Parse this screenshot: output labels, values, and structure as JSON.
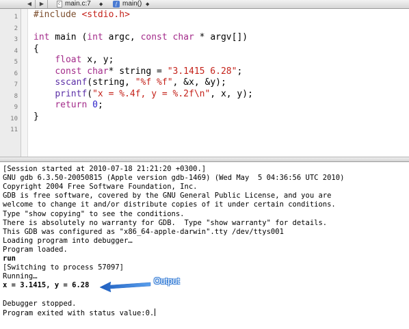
{
  "navbar": {
    "back_icon": "back-arrow-icon",
    "forward_icon": "forward-arrow-icon",
    "file_label": "main.c:7",
    "function_label": "main()",
    "stepper_glyph": "◆"
  },
  "editor": {
    "line_numbers": [
      "1",
      "2",
      "3",
      "4",
      "5",
      "6",
      "7",
      "8",
      "9",
      "10",
      "11"
    ],
    "lines": [
      [
        {
          "t": "#include ",
          "c": "pp"
        },
        {
          "t": "<stdio.h>",
          "c": "str"
        }
      ],
      [],
      [
        {
          "t": "int",
          "c": "kw"
        },
        {
          "t": " main (",
          "c": "plain"
        },
        {
          "t": "int",
          "c": "kw"
        },
        {
          "t": " argc, ",
          "c": "plain"
        },
        {
          "t": "const",
          "c": "kw"
        },
        {
          "t": " ",
          "c": "plain"
        },
        {
          "t": "char",
          "c": "kw"
        },
        {
          "t": " * argv[])",
          "c": "plain"
        }
      ],
      [
        {
          "t": "{",
          "c": "plain"
        }
      ],
      [
        {
          "t": "    ",
          "c": "plain"
        },
        {
          "t": "float",
          "c": "kw"
        },
        {
          "t": " x, y;",
          "c": "plain"
        }
      ],
      [
        {
          "t": "    ",
          "c": "plain"
        },
        {
          "t": "const",
          "c": "kw"
        },
        {
          "t": " ",
          "c": "plain"
        },
        {
          "t": "char",
          "c": "kw"
        },
        {
          "t": "* string = ",
          "c": "plain"
        },
        {
          "t": "\"3.1415 6.28\"",
          "c": "str"
        },
        {
          "t": ";",
          "c": "plain"
        }
      ],
      [
        {
          "t": "    ",
          "c": "plain"
        },
        {
          "t": "sscanf",
          "c": "fn"
        },
        {
          "t": "(string, ",
          "c": "plain"
        },
        {
          "t": "\"%f %f\"",
          "c": "str"
        },
        {
          "t": ", &x, &y);",
          "c": "plain"
        }
      ],
      [
        {
          "t": "    ",
          "c": "plain"
        },
        {
          "t": "printf",
          "c": "fn"
        },
        {
          "t": "(",
          "c": "plain"
        },
        {
          "t": "\"x = %.4f, y = %.2f\\n\"",
          "c": "str"
        },
        {
          "t": ", x, y);",
          "c": "plain"
        }
      ],
      [
        {
          "t": "    ",
          "c": "plain"
        },
        {
          "t": "return",
          "c": "kw"
        },
        {
          "t": " ",
          "c": "plain"
        },
        {
          "t": "0",
          "c": "num"
        },
        {
          "t": ";",
          "c": "plain"
        }
      ],
      [
        {
          "t": "}",
          "c": "plain"
        }
      ],
      []
    ]
  },
  "console": {
    "lines": [
      {
        "text": "[Session started at 2010-07-18 21:21:20 +0300.]",
        "bold": false
      },
      {
        "text": "GNU gdb 6.3.50-20050815 (Apple version gdb-1469) (Wed May  5 04:36:56 UTC 2010)",
        "bold": false
      },
      {
        "text": "Copyright 2004 Free Software Foundation, Inc.",
        "bold": false
      },
      {
        "text": "GDB is free software, covered by the GNU General Public License, and you are",
        "bold": false
      },
      {
        "text": "welcome to change it and/or distribute copies of it under certain conditions.",
        "bold": false
      },
      {
        "text": "Type \"show copying\" to see the conditions.",
        "bold": false
      },
      {
        "text": "There is absolutely no warranty for GDB.  Type \"show warranty\" for details.",
        "bold": false
      },
      {
        "text": "This GDB was configured as \"x86_64-apple-darwin\".tty /dev/ttys001",
        "bold": false
      },
      {
        "text": "Loading program into debugger…",
        "bold": false
      },
      {
        "text": "Program loaded.",
        "bold": false
      },
      {
        "text": "run",
        "bold": true
      },
      {
        "text": "[Switching to process 57097]",
        "bold": false
      },
      {
        "text": "Running…",
        "bold": false
      },
      {
        "text": "x = 3.1415, y = 6.28",
        "bold": true
      },
      {
        "text": "",
        "bold": false
      },
      {
        "text": "Debugger stopped.",
        "bold": false
      },
      {
        "text": "Program exited with status value:0.",
        "bold": false
      }
    ]
  },
  "annotation": {
    "label": "Output",
    "color": "#3d82d8"
  }
}
